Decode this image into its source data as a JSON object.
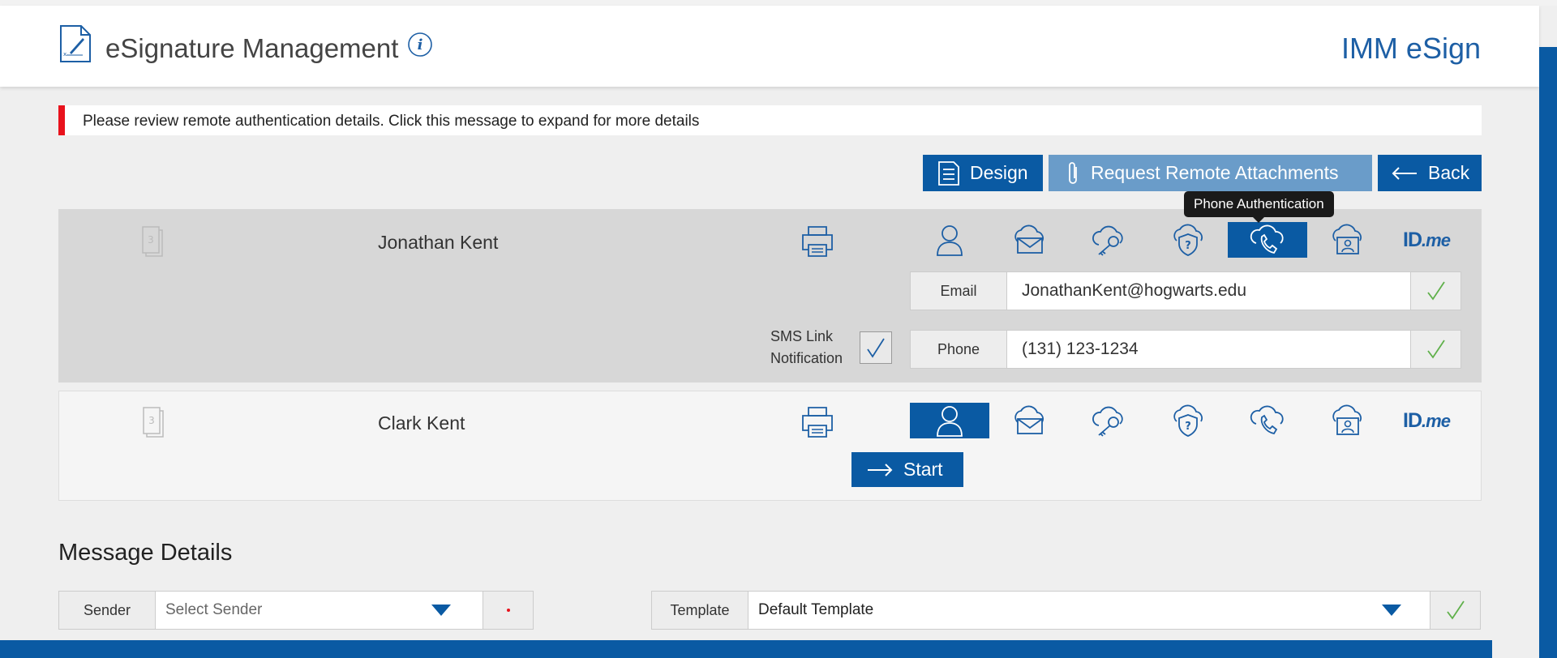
{
  "header": {
    "title": "eSignature Management",
    "brand": "IMM eSign"
  },
  "alert": {
    "message": "Please review remote authentication details. Click this message to expand for more details"
  },
  "toolbar": {
    "design_label": "Design",
    "attachments_label": "Request Remote Attachments",
    "back_label": "Back"
  },
  "tooltip": "Phone Authentication",
  "signers": [
    {
      "order": "3",
      "name": "Jonathan Kent",
      "email_label": "Email",
      "email": "JonathanKent@hogwarts.edu",
      "phone_label": "Phone",
      "phone": "(131) 123-1234",
      "sms_line1": "SMS Link",
      "sms_line2": "Notification",
      "selected_auth": "phone"
    },
    {
      "order": "3",
      "name": "Clark Kent",
      "start_label": "Start",
      "selected_auth": "user"
    }
  ],
  "auth_methods": [
    "user-icon",
    "email-cloud-icon",
    "key-cloud-icon",
    "question-shield-icon",
    "phone-cloud-icon",
    "id-card-icon",
    "idme-logo"
  ],
  "idme": {
    "id": "ID",
    "me": ".me"
  },
  "message_details": {
    "title": "Message Details",
    "sender_label": "Sender",
    "sender_value": "Select Sender",
    "template_label": "Template",
    "template_value": "Default Template"
  },
  "colors": {
    "primary": "#0a5aa3",
    "light_button": "#6a9cc9",
    "alert_red": "#e8121c",
    "check_green": "#5fb04a"
  }
}
